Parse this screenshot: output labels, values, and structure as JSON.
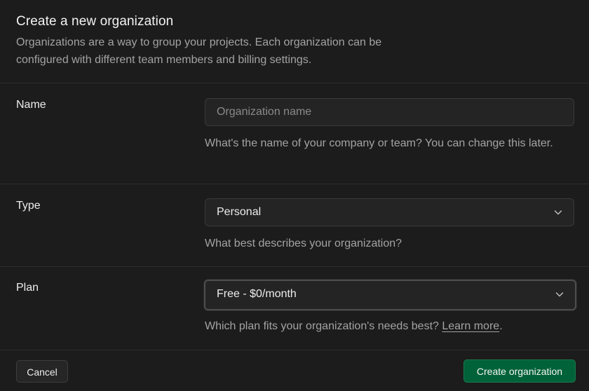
{
  "header": {
    "title": "Create a new organization",
    "subtitle": "Organizations are a way to group your projects. Each organization can be configured with different team members and billing settings."
  },
  "name_row": {
    "label": "Name",
    "placeholder": "Organization name",
    "value": "",
    "help": "What's the name of your company or team? You can change this later."
  },
  "type_row": {
    "label": "Type",
    "selected": "Personal",
    "help": "What best describes your organization?"
  },
  "plan_row": {
    "label": "Plan",
    "selected": "Free - $0/month",
    "help_prefix": "Which plan fits your organization's needs best? ",
    "help_link": "Learn more",
    "help_suffix": "."
  },
  "footer": {
    "cancel_label": "Cancel",
    "create_label": "Create organization"
  },
  "icons": {
    "chevron": "chevron-down-icon"
  },
  "colors": {
    "background": "#1c1c1c",
    "input_bg": "#242424",
    "border": "#2e2e2e",
    "primary_button": "#006239",
    "muted_text": "#a3a3a3"
  }
}
